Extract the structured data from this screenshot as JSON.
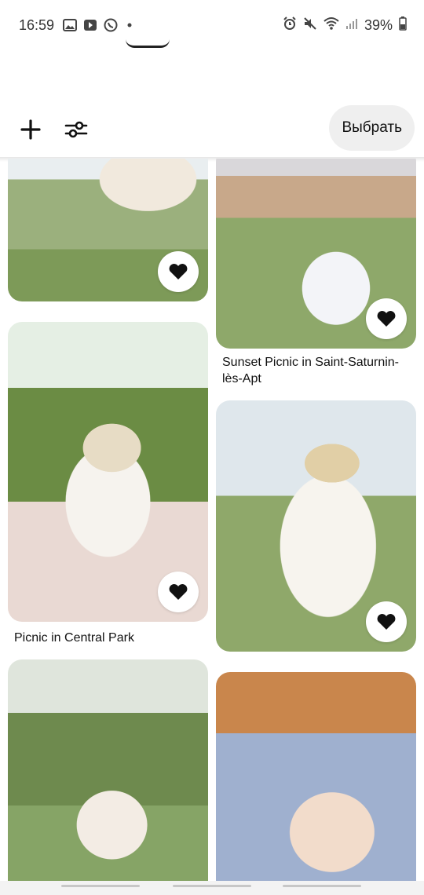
{
  "status_bar": {
    "time": "16:59",
    "battery": "39%",
    "left_icons": [
      "image-icon",
      "video-icon",
      "whatsapp-icon",
      "dot-icon"
    ],
    "right_icons": [
      "alarm-icon",
      "mute-icon",
      "wifi-icon",
      "signal-icon",
      "battery-icon"
    ]
  },
  "toolbar": {
    "add_icon": "plus-icon",
    "filter_icon": "filter-icon",
    "select_label": "Выбрать"
  },
  "pins": [
    {
      "title": "",
      "saved": true
    },
    {
      "title": "Sunset Picnic in Saint-Saturnin-lès-Apt",
      "saved": true
    },
    {
      "title": "Picnic in Central Park",
      "saved": true
    },
    {
      "title": "",
      "saved": true
    },
    {
      "title": "",
      "saved": false
    },
    {
      "title": "",
      "saved": false
    }
  ],
  "colors": {
    "select_bg": "#efefef",
    "heart": "#111111"
  }
}
